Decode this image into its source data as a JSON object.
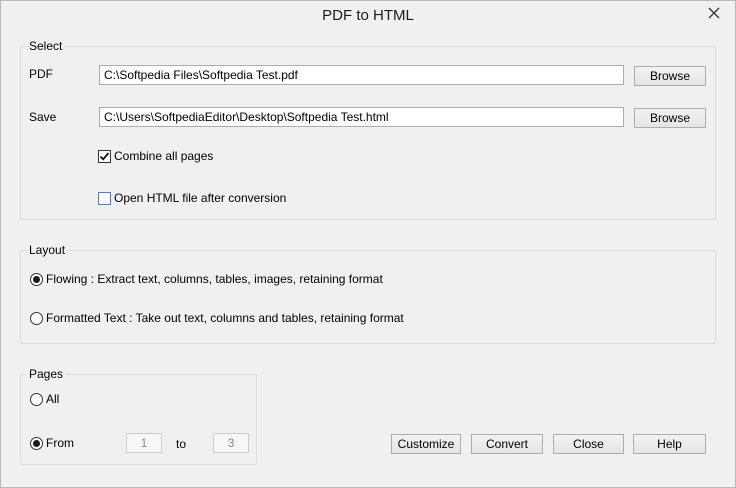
{
  "window": {
    "title": "PDF to HTML"
  },
  "select": {
    "legend": "Select",
    "pdf_label": "PDF",
    "pdf_value": "C:\\Softpedia Files\\Softpedia Test.pdf",
    "pdf_browse": "Browse",
    "save_label": "Save",
    "save_value": "C:\\Users\\SoftpediaEditor\\Desktop\\Softpedia Test.html",
    "save_browse": "Browse",
    "combine_label": "Combine all pages",
    "combine_checked": true,
    "open_label": "Open HTML file after conversion",
    "open_checked": false
  },
  "layout": {
    "legend": "Layout",
    "flowing_label": "Flowing :  Extract text, columns, tables, images, retaining format",
    "flowing_selected": true,
    "formatted_label": "Formatted Text :  Take out text, columns and tables, retaining format",
    "formatted_selected": false
  },
  "pages": {
    "legend": "Pages",
    "all_label": "All",
    "all_selected": false,
    "from_label": "From",
    "from_selected": true,
    "from_value": "1",
    "to_label": "to",
    "to_value": "3"
  },
  "actions": {
    "customize": "Customize",
    "convert": "Convert",
    "close": "Close",
    "help": "Help"
  },
  "icons": {
    "close": "close-icon",
    "checkmark": "checkmark-icon"
  }
}
